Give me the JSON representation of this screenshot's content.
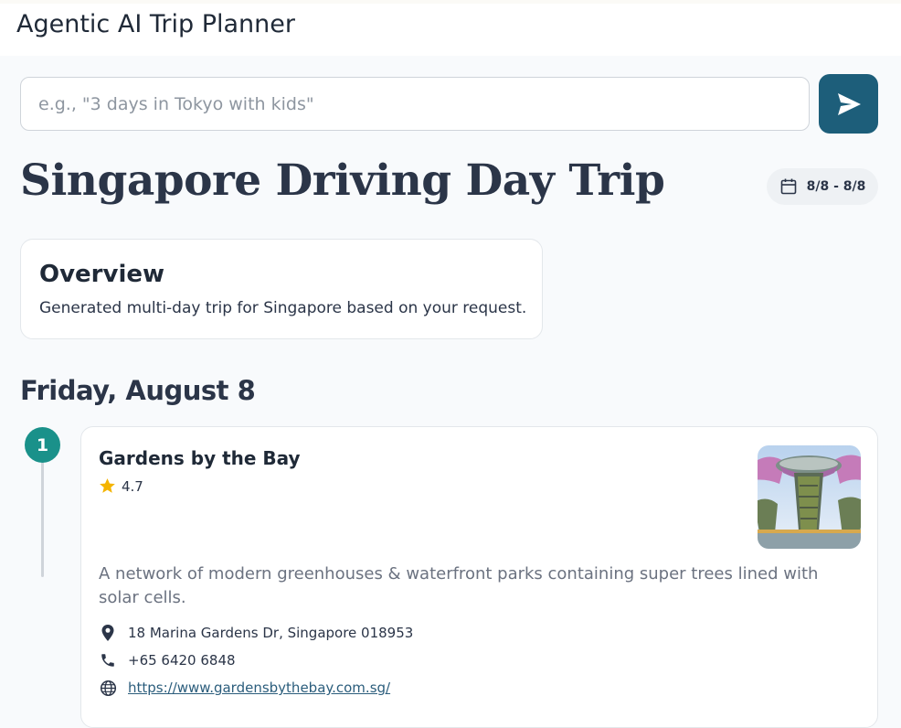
{
  "app": {
    "title": "Agentic AI Trip Planner"
  },
  "search": {
    "placeholder": "e.g., \"3 days in Tokyo with kids\"",
    "value": ""
  },
  "trip": {
    "title": "Singapore Driving Day Trip",
    "date_range": "8/8 - 8/8",
    "overview": {
      "title": "Overview",
      "text": "Generated multi-day trip for Singapore based on your request."
    }
  },
  "days": [
    {
      "heading": "Friday, August 8",
      "places": [
        {
          "number": "1",
          "name": "Gardens by the Bay",
          "rating": "4.7",
          "description": "A network of modern greenhouses & waterfront parks containing super trees lined with solar cells.",
          "address": "18 Marina Gardens Dr, Singapore 018953",
          "phone": "+65 6420 6848",
          "website": "https://www.gardensbythebay.com.sg/"
        }
      ]
    }
  ],
  "icons": {
    "send": "send-icon",
    "calendar": "calendar-icon",
    "star": "star-icon",
    "location": "location-pin-icon",
    "phone": "phone-icon",
    "globe": "globe-icon"
  },
  "colors": {
    "accent": "#1d5e7a",
    "step_badge": "#1a918a",
    "star": "#f4b400",
    "link": "#2b5d7c"
  }
}
